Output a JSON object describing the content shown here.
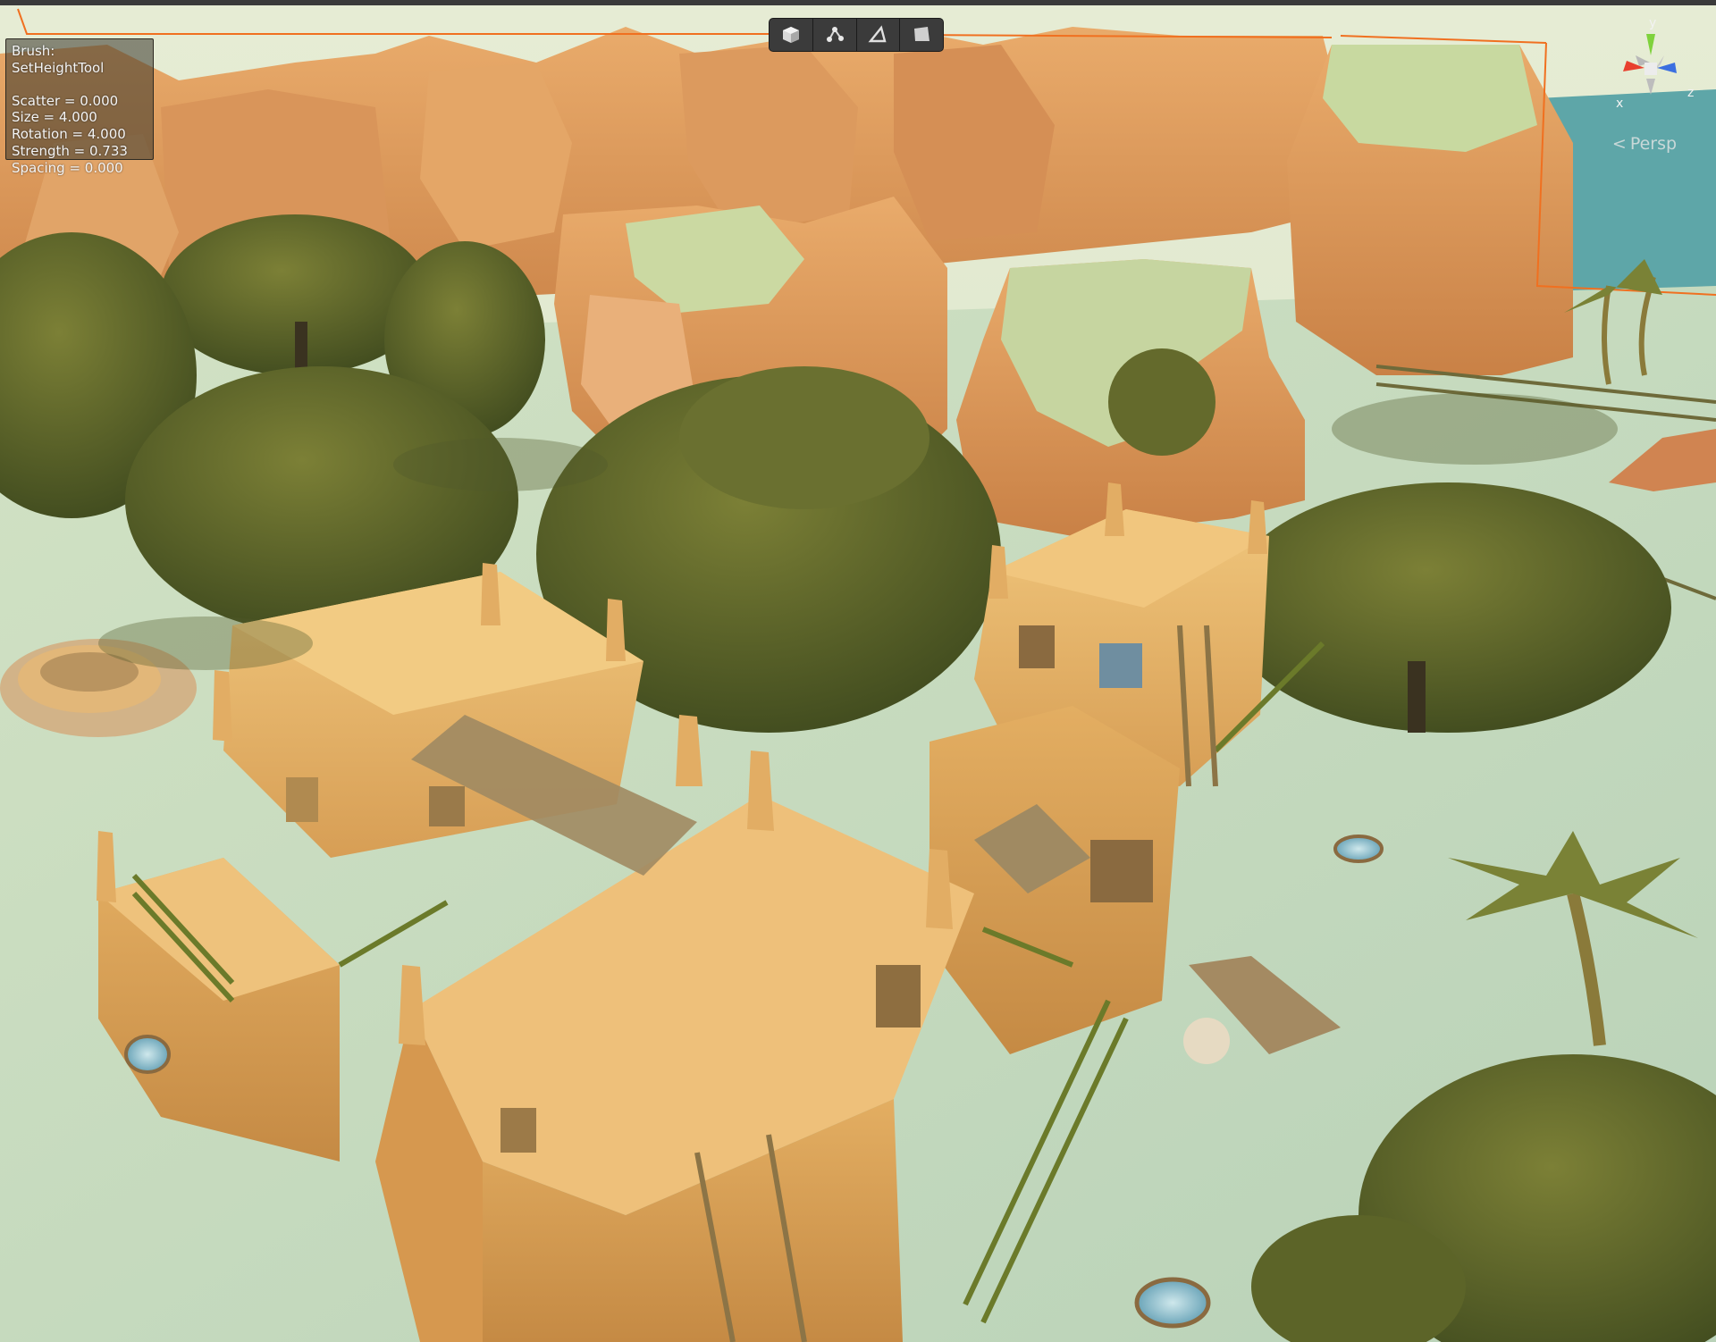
{
  "brush_panel": {
    "title": "Brush: SetHeightTool",
    "lines": [
      "Scatter = 0.000",
      "Size = 4.000",
      "Rotation = 4.000",
      "Strength = 0.733",
      "Spacing = 0.000"
    ]
  },
  "toolbar": {
    "buttons": [
      {
        "name": "object-mode-button",
        "icon": "cube-icon"
      },
      {
        "name": "vertex-mode-button",
        "icon": "vertex-nodes-icon"
      },
      {
        "name": "edge-mode-button",
        "icon": "triangle-edge-icon"
      },
      {
        "name": "face-mode-button",
        "icon": "face-icon"
      }
    ]
  },
  "gizmo": {
    "axis_y": "y",
    "axis_x": "x",
    "axis_z": "z",
    "projection_label": "Persp",
    "colors": {
      "x": "#e8402e",
      "y": "#7fd23c",
      "z": "#3b6fe0"
    }
  },
  "scene": {
    "colors": {
      "sky": "#dfe8ce",
      "sand": "#cfe0c8",
      "cliff": "#e0a063",
      "cliff_top": "#c8d8a0",
      "building": "#e8b86c",
      "tree": "#55602a",
      "water": "#5ea6a8",
      "selection_outline": "#f07020"
    }
  }
}
